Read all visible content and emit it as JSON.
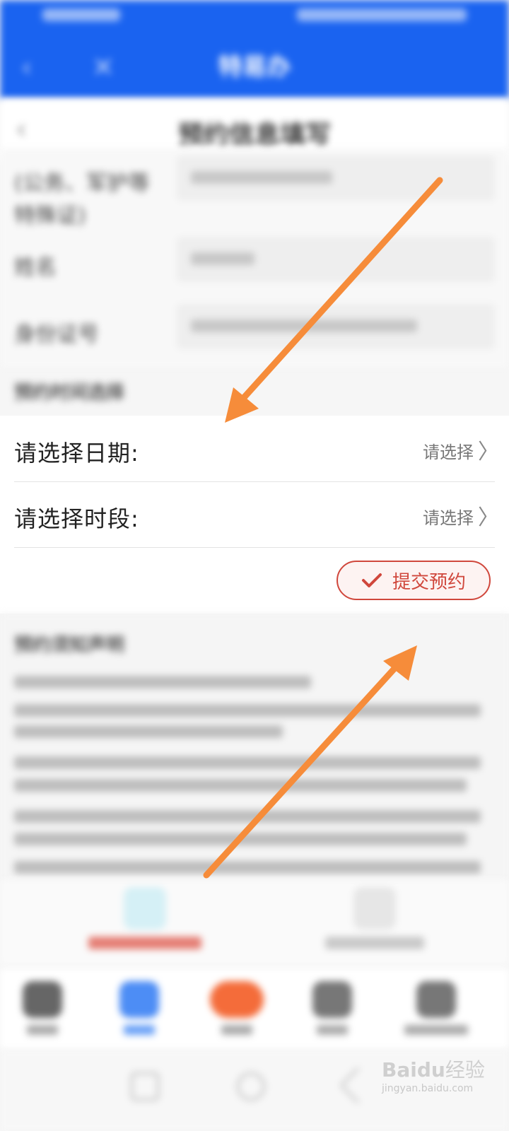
{
  "app_bar": {
    "title": "特易办"
  },
  "page_header": {
    "title": "预约信息填写"
  },
  "form_top": {
    "fields": [
      {
        "label": "(公务、军护等"
      },
      {
        "label": "姓名"
      },
      {
        "label": "身份证号"
      }
    ],
    "sublabel": "特殊证)"
  },
  "time_section": {
    "heading": "预约时间选择",
    "date_label": "请选择日期:",
    "date_value": "请选择",
    "period_label": "请选择时段:",
    "period_value": "请选择",
    "submit_label": "提交预约",
    "chevron": "〉"
  },
  "notice": {
    "heading": "预约须知声明"
  },
  "colors": {
    "app_bar": "#1a63f0",
    "submit": "#d0473c",
    "arrow": "#f68c3a"
  },
  "icons": [
    "back-icon",
    "close-icon",
    "chevron-right-icon",
    "checkmark-icon"
  ],
  "watermark": {
    "logo": "Bai",
    "suffix": "经验",
    "url": "jingyan.baidu.com"
  }
}
